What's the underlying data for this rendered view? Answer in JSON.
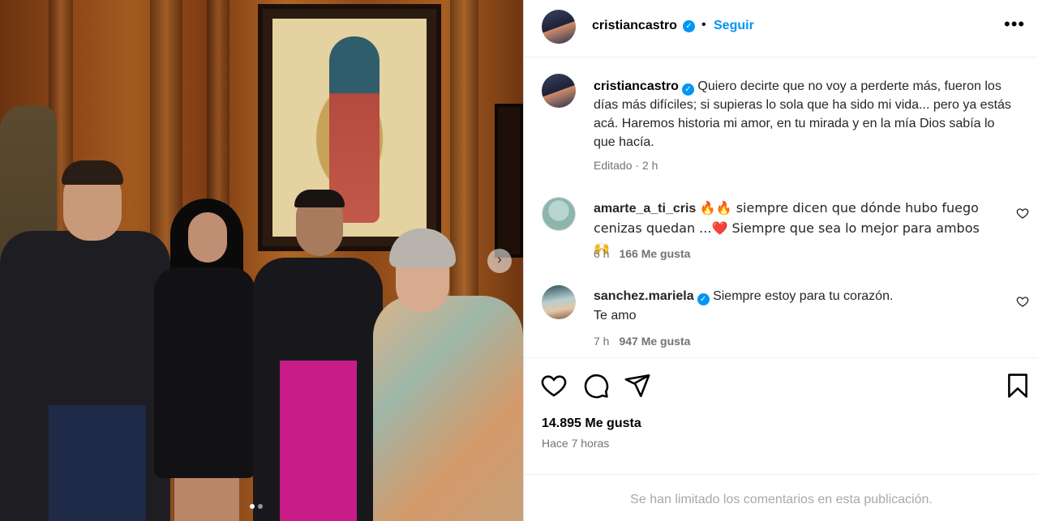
{
  "post": {
    "author": "cristiancastro",
    "follow_label": "Seguir",
    "separator": "•",
    "more_label": "•••",
    "carousel_next": "›"
  },
  "caption": {
    "username": "cristiancastro",
    "text": "Quiero decirte que no voy a perderte más, fueron los días más difíciles; si supieras lo sola que ha sido mi vida... pero ya estás acá. Haremos historia mi amor, en tu mirada y en la mía Dios sabía lo que hacía.",
    "meta": "Editado · 2 h"
  },
  "comments": [
    {
      "username": "amarte_a_ti_cris",
      "text_part1": "🔥🔥 siempre dicen que dónde hubo fuego cenizas quedan ...",
      "heart": "❤️",
      "text_part2": " Siempre que sea lo mejor para ambos 🙌",
      "time": "6 h",
      "likes": "166 Me gusta"
    },
    {
      "username": "sanchez.mariela",
      "text": "Siempre estoy para tu corazón.",
      "text_line2": "Te amo",
      "time": "7 h",
      "likes": "947 Me gusta"
    }
  ],
  "likes_count": "14.895 Me gusta",
  "time_ago": "Hace 7 horas",
  "comments_limited": "Se han limitado los comentarios en esta publicación.",
  "colors": {
    "accent": "#0095f6",
    "muted": "#737373",
    "text": "#262626",
    "border": "#efefef"
  },
  "carousel": {
    "total_slides": 2,
    "current_slide": 1
  }
}
